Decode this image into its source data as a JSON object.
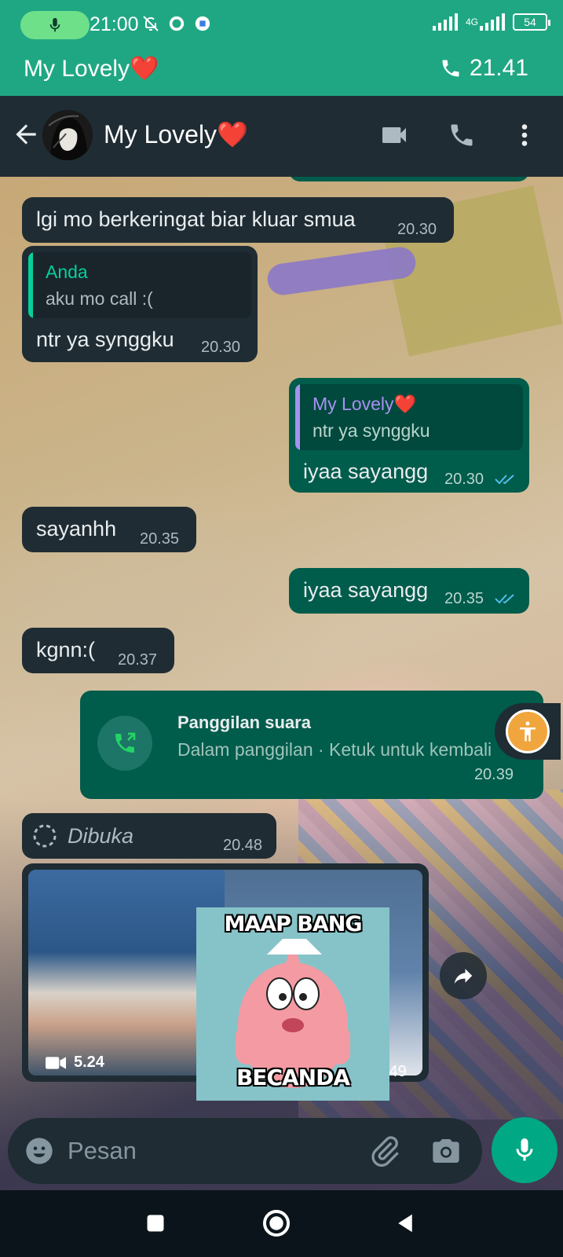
{
  "status_bar": {
    "time": "21:00",
    "network": "4G",
    "battery": "54"
  },
  "call_banner": {
    "name": "My Lovely❤️",
    "duration": "21.41"
  },
  "header": {
    "contact_name": "My Lovely❤️"
  },
  "messages": [
    {
      "direction": "in",
      "text": "lgi mo berkeringat biar kluar smua",
      "time": "20.30"
    },
    {
      "direction": "in",
      "quote_author": "Anda",
      "quote_text": "aku mo call :(",
      "text": "ntr ya synggku",
      "time": "20.30"
    },
    {
      "direction": "out",
      "quote_author": "My Lovely❤️",
      "quote_text": "ntr ya synggku",
      "text": "iyaa sayangg",
      "time": "20.30",
      "status": "read"
    },
    {
      "direction": "in",
      "text": "sayanhh",
      "time": "20.35"
    },
    {
      "direction": "out",
      "text": "iyaa sayangg",
      "time": "20.35",
      "status": "read"
    },
    {
      "direction": "in",
      "text": "kgnn:(",
      "time": "20.37"
    },
    {
      "direction": "out",
      "type": "call",
      "title": "Panggilan suara",
      "subtitle": "Dalam panggilan · Ketuk untuk kembali",
      "time": "20.39"
    },
    {
      "direction": "in",
      "type": "view_once",
      "text": "Dibuka",
      "time": "20.48"
    }
  ],
  "media": {
    "video_duration": "5.24",
    "time_partial": ".49",
    "meme_top": "MAAP BANG",
    "meme_bottom": "BECANDA"
  },
  "composer": {
    "placeholder": "Pesan"
  },
  "colors": {
    "accent": "#00a884",
    "outgoing_bubble": "#005c4b",
    "incoming_bubble": "#1f2c33",
    "header": "#1f2c33",
    "call_banner": "#1fa783",
    "read_ticks": "#53bdeb"
  },
  "icons": [
    "mic-icon",
    "back-arrow-icon",
    "video-call-icon",
    "phone-icon",
    "more-options-icon",
    "phone-call-icon",
    "accessibility-icon",
    "video-icon",
    "forward-icon",
    "emoji-icon",
    "attach-icon",
    "camera-icon",
    "nav-recents-icon",
    "nav-home-icon",
    "nav-back-icon"
  ]
}
